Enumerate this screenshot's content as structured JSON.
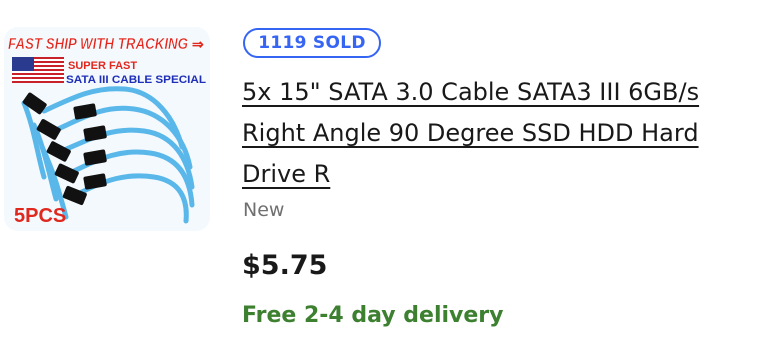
{
  "listing": {
    "image": {
      "banner_text": "FAST SHIP WITH TRACKING",
      "flag_caption_1": "SUPER FAST",
      "flag_caption_2": "SATA III CABLE SPECIAL",
      "quantity_text": "5PCS",
      "cable_color": "#5ab7ea",
      "banner_color": "#e0281f",
      "caption_color": "#1f2fb8"
    },
    "sold_badge": "1119 SOLD",
    "title": "5x 15\" SATA 3.0 Cable SATA3 III 6GB/s Right Angle 90 Degree SSD HDD Hard Drive R",
    "condition": "New",
    "price": "$5.75",
    "delivery": "Free 2-4 day delivery",
    "colors": {
      "accent": "#3665f3",
      "delivery_green": "#3c8030",
      "muted": "#707070"
    }
  }
}
